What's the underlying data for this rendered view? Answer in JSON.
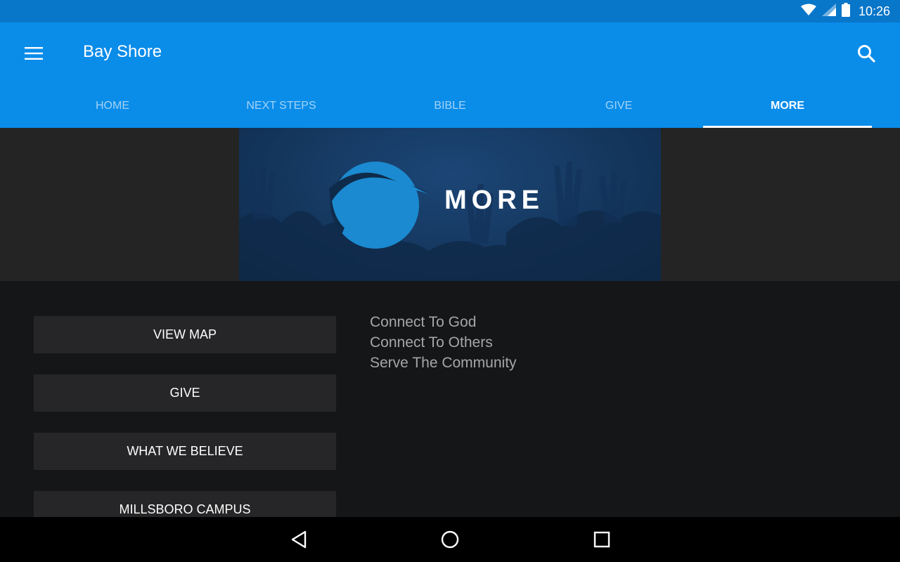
{
  "status_bar": {
    "time": "10:26",
    "icons": [
      "wifi-icon",
      "signal-icon",
      "battery-icon"
    ]
  },
  "app_bar": {
    "title": "Bay Shore",
    "menu_icon": "hamburger-menu-icon",
    "search_icon": "search-icon"
  },
  "tabs": [
    {
      "label": "HOME",
      "active": false
    },
    {
      "label": "NEXT STEPS",
      "active": false
    },
    {
      "label": "BIBLE",
      "active": false
    },
    {
      "label": "GIVE",
      "active": false
    },
    {
      "label": "MORE",
      "active": true
    }
  ],
  "banner": {
    "text": "MORE"
  },
  "buttons": [
    "VIEW MAP",
    "GIVE",
    "WHAT WE BELIEVE",
    "MILLSBORO CAMPUS"
  ],
  "links": [
    "Connect To God",
    "Connect To Others",
    "Serve The Community"
  ],
  "nav_bar": {
    "icons": [
      "back-icon",
      "home-icon",
      "recents-icon"
    ]
  },
  "colors": {
    "status_bar": "#0876c9",
    "app_bar": "#0a8ce9",
    "logo": "#1b8ad0",
    "content_bg": "#151618",
    "button_bg": "#262628"
  }
}
